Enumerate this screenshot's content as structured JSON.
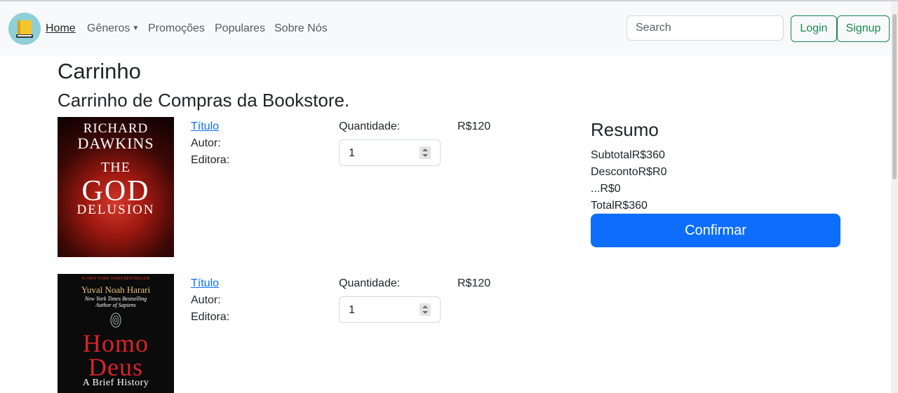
{
  "navbar": {
    "links": [
      {
        "label": "Home",
        "active": true
      },
      {
        "label": "Gêneros",
        "dropdown": true
      },
      {
        "label": "Promoções"
      },
      {
        "label": "Populares"
      },
      {
        "label": "Sobre Nós"
      }
    ],
    "search_placeholder": "Search",
    "login_label": "Login",
    "signup_label": "Signup",
    "logo_icon": "book-icon"
  },
  "page": {
    "title": "Carrinho",
    "subtitle": "Carrinho de Compras da Bookstore."
  },
  "cart": {
    "items": [
      {
        "cover": {
          "author_line1": "RICHARD",
          "author_line2": "DAWKINS",
          "title_line1": "THE",
          "title_line2": "GOD",
          "title_line3": "DELUSION"
        },
        "title_label": "Título",
        "author_label": "Autor:",
        "publisher_label": "Editora:",
        "quantity_label": "Quantidade:",
        "quantity": "1",
        "price": "R$120"
      },
      {
        "cover": {
          "banner": "#1 NEW YORK TIMES BESTSELLER",
          "author": "Yuval Noah Harari",
          "tagline1": "New York Times Bestselling",
          "tagline2": "Author of Sapiens",
          "title_line1": "Homo",
          "title_line2": "Deus",
          "subtitle": "A Brief History"
        },
        "title_label": "Título",
        "author_label": "Autor:",
        "publisher_label": "Editora:",
        "quantity_label": "Quantidade:",
        "quantity": "1",
        "price": "R$120"
      }
    ]
  },
  "summary": {
    "title": "Resumo",
    "subtotal": "SubtotalR$360",
    "discount": "DescontoR$R0",
    "other": "...R$0",
    "total": "TotalR$360",
    "confirm_label": "Confirmar"
  },
  "colors": {
    "primary": "#0d6efd",
    "success": "#198754",
    "navbar_bg": "#f8f9fa"
  }
}
